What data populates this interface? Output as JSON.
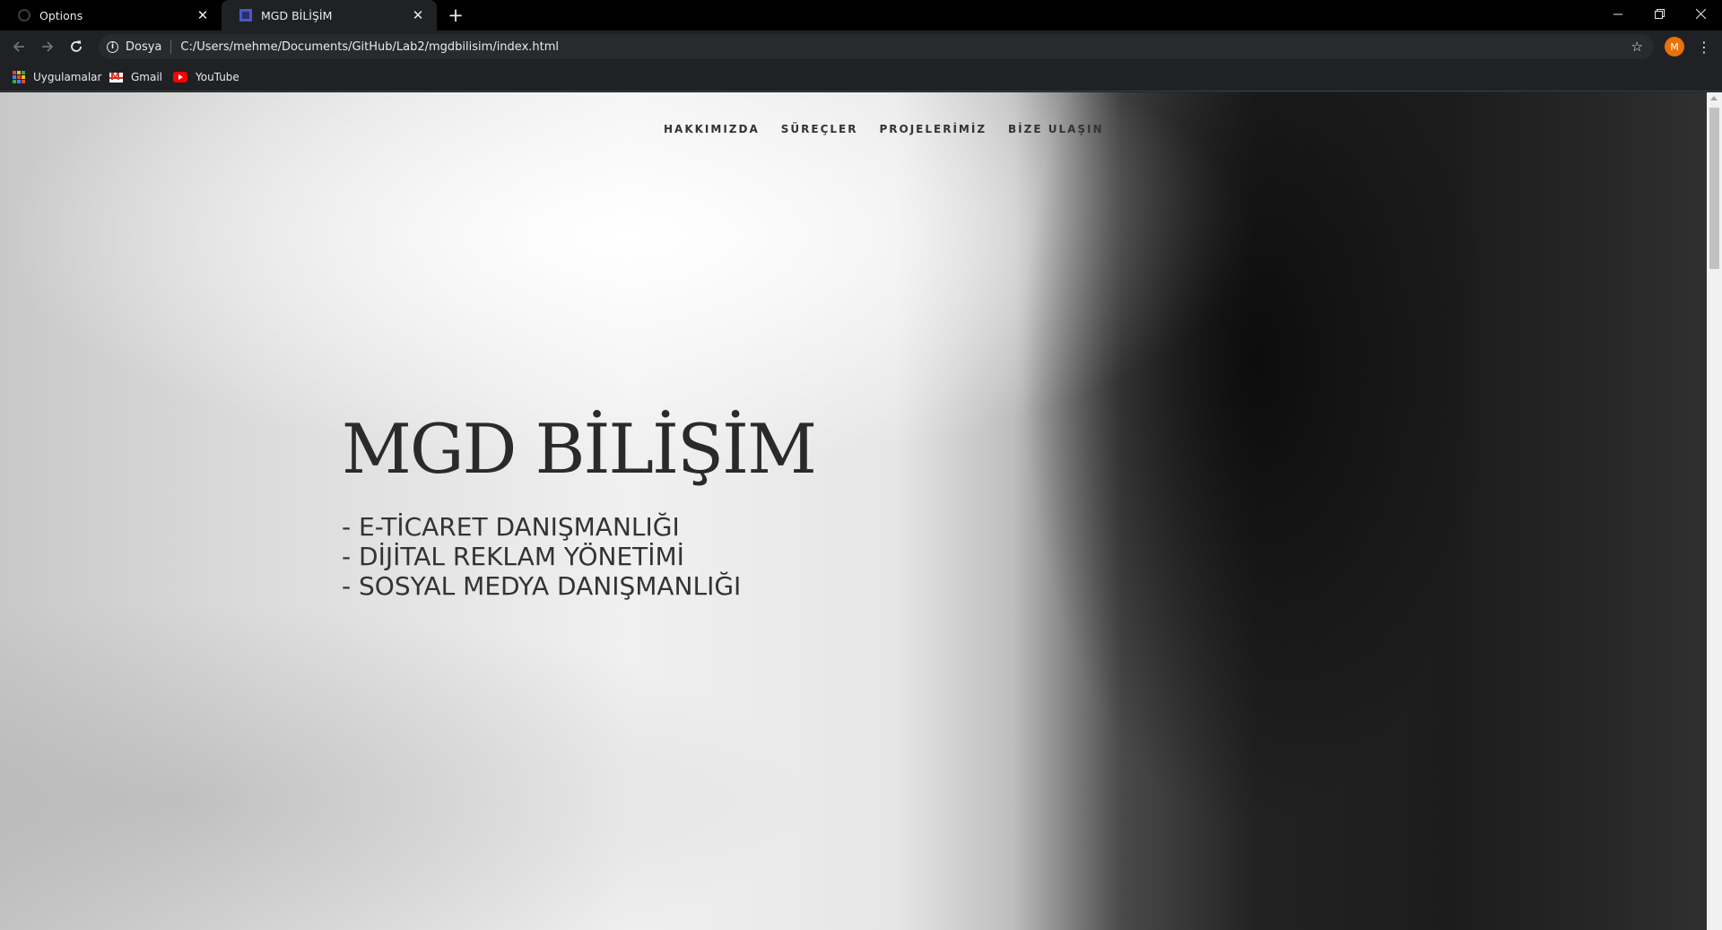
{
  "browser": {
    "tabs": [
      {
        "title": "Options"
      },
      {
        "title": "MGD BİLİŞİM"
      }
    ],
    "address_bar": {
      "scheme_label": "Dosya",
      "url": "C:/Users/mehme/Documents/GitHub/Lab2/mgdbilisim/index.html"
    },
    "profile_initial": "M",
    "bookmarks": [
      {
        "label": "Uygulamalar",
        "icon": "apps-grid-icon"
      },
      {
        "label": "Gmail",
        "icon": "gmail-icon"
      },
      {
        "label": "YouTube",
        "icon": "youtube-icon"
      }
    ]
  },
  "page": {
    "nav": [
      {
        "label": "HAKKIMIZDA"
      },
      {
        "label": "SÜREÇLER"
      },
      {
        "label": "PROJELERİMİZ"
      },
      {
        "label": "BİZE ULAŞIN"
      }
    ],
    "hero": {
      "title": "MGD BİLİŞİM",
      "lines": [
        "- E-TİCARET DANIŞMANLIĞI",
        "- DİJİTAL REKLAM YÖNETİMİ",
        "- SOSYAL MEDYA DANIŞMANLIĞI"
      ]
    }
  }
}
